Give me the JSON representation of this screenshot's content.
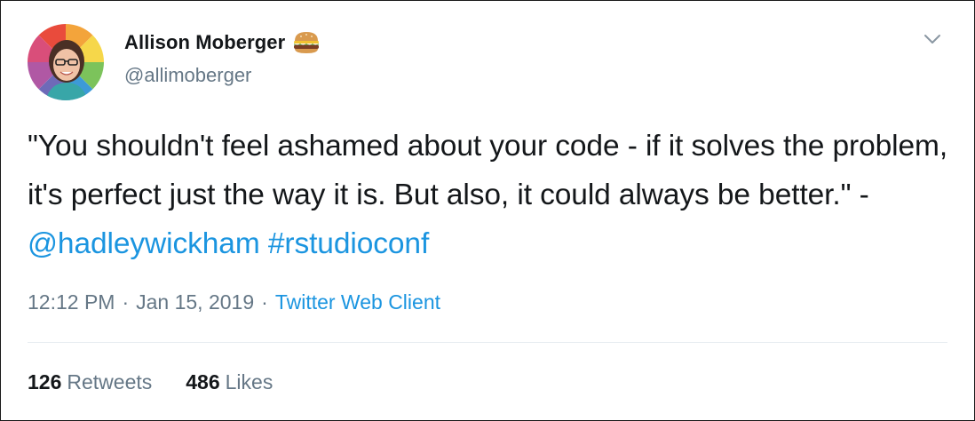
{
  "author": {
    "display_name": "Allison Moberger",
    "name_emoji_icon": "hamburger-emoji-icon",
    "handle": "@allimoberger",
    "avatar_icon": "profile-photo"
  },
  "tweet": {
    "text_before_links": "\"You shouldn't feel ashamed about your code - if it solves the problem, it's perfect just the way it is. But also, it could always be better.\" -",
    "mention": "@hadleywickham",
    "hashtag": "#rstudioconf"
  },
  "meta": {
    "time": "12:12 PM",
    "separator": "·",
    "date": "Jan 15, 2019",
    "source": "Twitter Web Client"
  },
  "stats": {
    "retweets_count": "126",
    "retweets_label": "Retweets",
    "likes_count": "486",
    "likes_label": "Likes"
  },
  "colors": {
    "text": "#14171a",
    "secondary": "#657786",
    "link": "#1b95e0",
    "divider": "#e6ecf0"
  },
  "icons": {
    "menu": "chevron-down-icon"
  }
}
